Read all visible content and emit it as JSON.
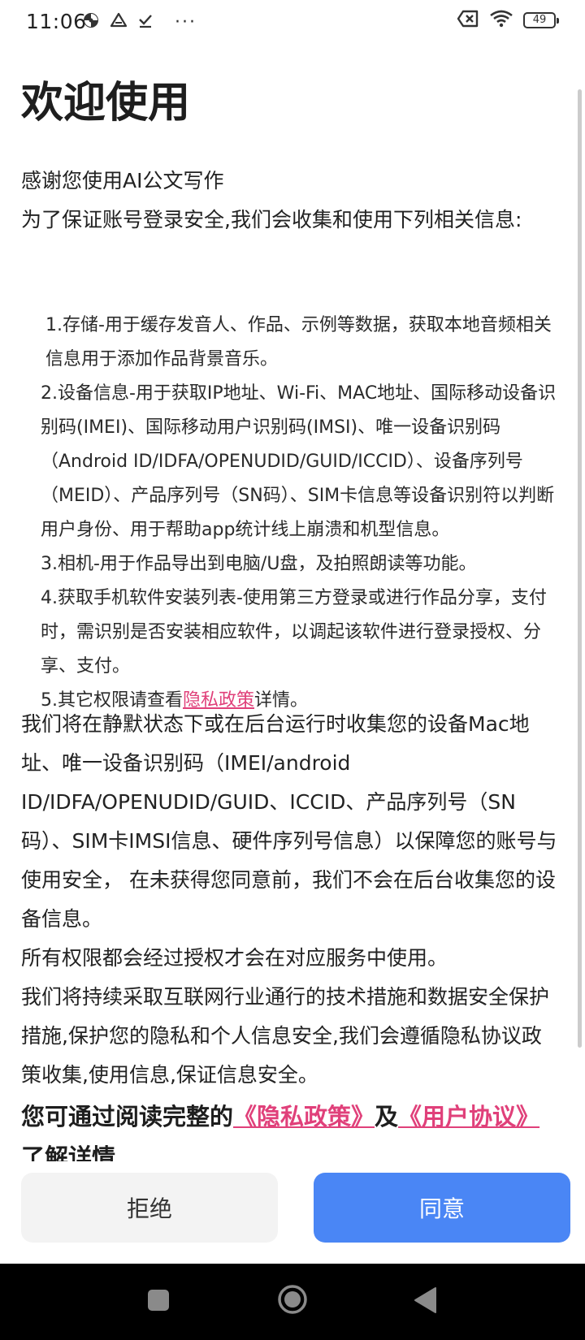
{
  "status_bar": {
    "time": "11:06",
    "battery": "49",
    "more": "···"
  },
  "page": {
    "title": "欢迎使用",
    "intro": [
      "感谢您使用AI公文写作",
      "为了保证账号登录安全,我们会收集和使用下列相关信息:"
    ],
    "permissions": {
      "item1": "1.存储-用于缓存发音人、作品、示例等数据，获取本地音频相关信息用于添加作品背景音乐。",
      "item2": "2.设备信息-用于获取IP地址、Wi-Fi、MAC地址、国际移动设备识别码(IMEI)、国际移动用户识别码(IMSI)、唯一设备识别码（Android ID/IDFA/OPENUDID/GUID/ICCID）、设备序列号（MEID）、产品序列号（SN码）、SIM卡信息等设备识别符以判断用户身份、用于帮助app统计线上崩溃和机型信息。",
      "item3": "3.相机-用于作品导出到电脑/U盘，及拍照朗读等功能。",
      "item4": "4.获取手机软件安装列表-使用第三方登录或进行作品分享，支付时，需识别是否安装相应软件，以调起该软件进行登录授权、分享、支付。",
      "item5_prefix": "5.其它权限请查看",
      "item5_link": "隐私政策",
      "item5_suffix": "详情。"
    },
    "detail": [
      "我们将在静默状态下或在后台运行时收集您的设备Mac地址、唯一设备识别码（IMEI/android ID/IDFA/OPENUDID/GUID、ICCID、产品序列号（SN码）、SIM卡IMSI信息、硬件序列号信息）以保障您的账号与使用安全， 在未获得您同意前，我们不会在后台收集您的设备信息。",
      "所有权限都会经过授权才会在对应服务中使用。",
      "我们将持续采取互联网行业通行的技术措施和数据安全保护措施,保护您的隐私和个人信息安全,我们会遵循隐私协议政策收集,使用信息,保证信息安全。"
    ],
    "read_more": {
      "prefix": "您可通过阅读完整的",
      "privacy_link": "《隐私政策》",
      "and": "及",
      "user_link": "《用户协议》",
      "suffix": "了解详情"
    }
  },
  "buttons": {
    "reject": "拒绝",
    "agree": "同意"
  },
  "colors": {
    "link": "#e0407a",
    "primary": "#4a86f5",
    "secondary_bg": "#f3f3f3"
  }
}
